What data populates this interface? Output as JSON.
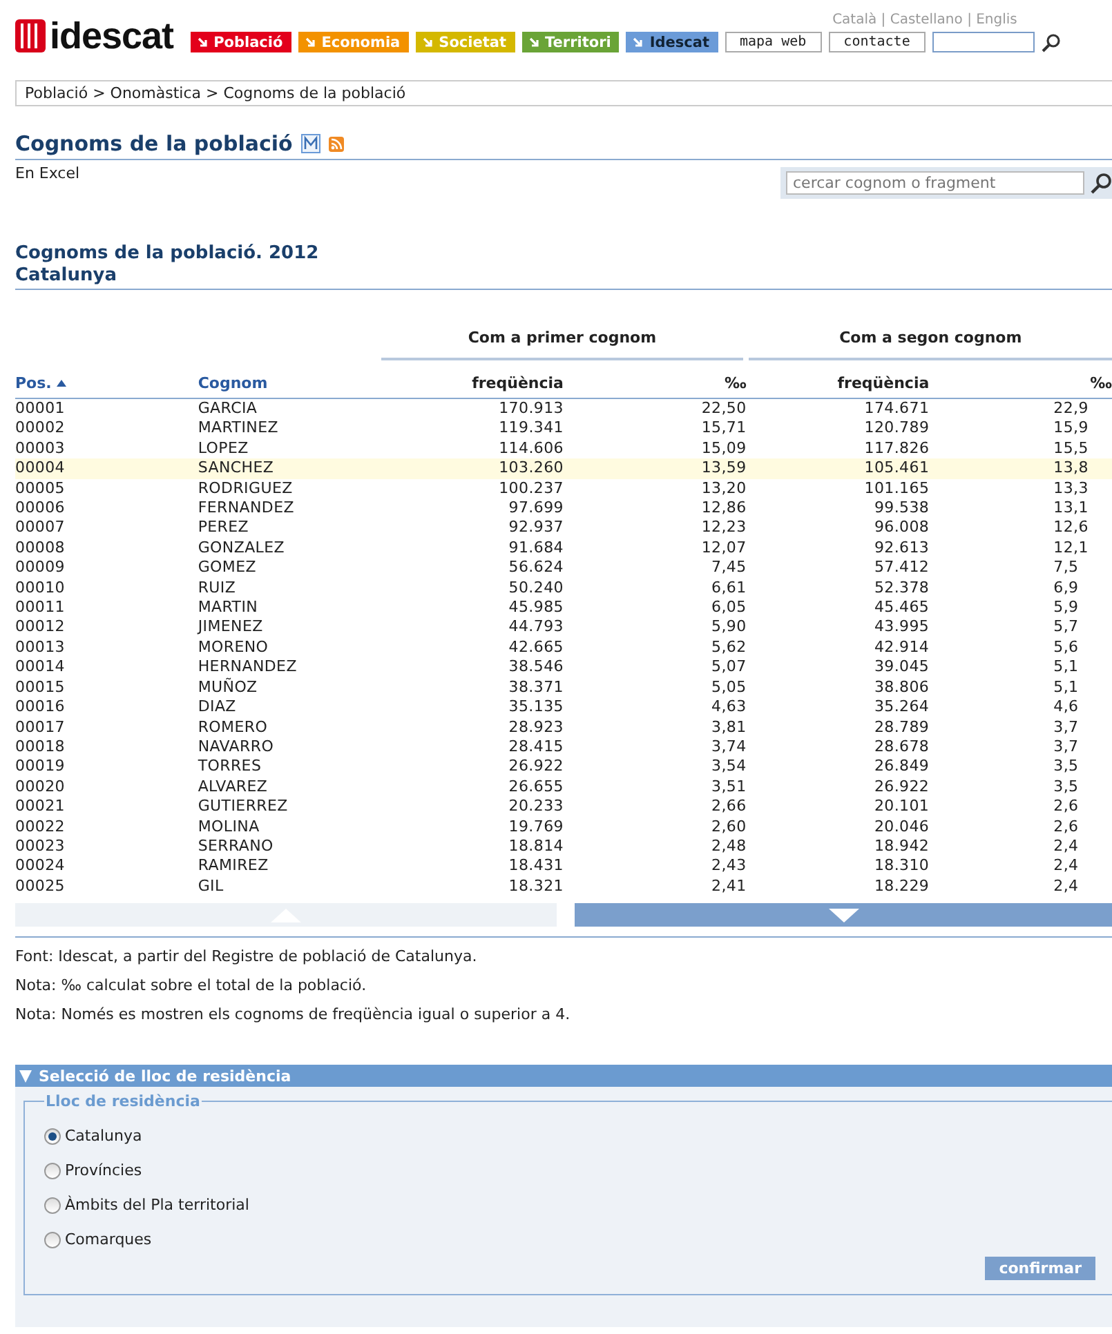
{
  "header": {
    "logo": "idescat",
    "languages": "Català | Castellano | Englis",
    "nav": [
      {
        "label": "Població",
        "color": "#e3001b"
      },
      {
        "label": "Economia",
        "color": "#f39200"
      },
      {
        "label": "Societat",
        "color": "#d4b800"
      },
      {
        "label": "Territori",
        "color": "#6aa437"
      },
      {
        "label": "Idescat",
        "color": "#6b9bd8"
      }
    ],
    "links": [
      "mapa web",
      "contacte"
    ]
  },
  "breadcrumb": "Població > Onomàstica > Cognoms de la població",
  "page_title": "Cognoms de la població",
  "excel_link": "En Excel",
  "search": {
    "placeholder": "cercar cognom o fragment"
  },
  "table": {
    "title": "Cognoms de la població. 2012",
    "subtitle": "Catalunya",
    "groups": [
      "Com a primer cognom",
      "Com a segon cognom"
    ],
    "columns": [
      "Pos.",
      "Cognom",
      "freqüència",
      "‰",
      "freqüència",
      "‰"
    ],
    "rows": [
      {
        "cells": [
          "00001",
          "GARCIA",
          "170.913",
          "22,50",
          "174.671",
          "22,9"
        ],
        "selected": false
      },
      {
        "cells": [
          "00002",
          "MARTINEZ",
          "119.341",
          "15,71",
          "120.789",
          "15,9"
        ],
        "selected": false
      },
      {
        "cells": [
          "00003",
          "LOPEZ",
          "114.606",
          "15,09",
          "117.826",
          "15,5"
        ],
        "selected": false
      },
      {
        "cells": [
          "00004",
          "SANCHEZ",
          "103.260",
          "13,59",
          "105.461",
          "13,8"
        ],
        "selected": true
      },
      {
        "cells": [
          "00005",
          "RODRIGUEZ",
          "100.237",
          "13,20",
          "101.165",
          "13,3"
        ],
        "selected": false
      },
      {
        "cells": [
          "00006",
          "FERNANDEZ",
          "97.699",
          "12,86",
          "99.538",
          "13,1"
        ],
        "selected": false
      },
      {
        "cells": [
          "00007",
          "PEREZ",
          "92.937",
          "12,23",
          "96.008",
          "12,6"
        ],
        "selected": false
      },
      {
        "cells": [
          "00008",
          "GONZALEZ",
          "91.684",
          "12,07",
          "92.613",
          "12,1"
        ],
        "selected": false
      },
      {
        "cells": [
          "00009",
          "GOMEZ",
          "56.624",
          "7,45",
          "57.412",
          "7,5"
        ],
        "selected": false
      },
      {
        "cells": [
          "00010",
          "RUIZ",
          "50.240",
          "6,61",
          "52.378",
          "6,9"
        ],
        "selected": false
      },
      {
        "cells": [
          "00011",
          "MARTIN",
          "45.985",
          "6,05",
          "45.465",
          "5,9"
        ],
        "selected": false
      },
      {
        "cells": [
          "00012",
          "JIMENEZ",
          "44.793",
          "5,90",
          "43.995",
          "5,7"
        ],
        "selected": false
      },
      {
        "cells": [
          "00013",
          "MORENO",
          "42.665",
          "5,62",
          "42.914",
          "5,6"
        ],
        "selected": false
      },
      {
        "cells": [
          "00014",
          "HERNANDEZ",
          "38.546",
          "5,07",
          "39.045",
          "5,1"
        ],
        "selected": false
      },
      {
        "cells": [
          "00015",
          "MUÑOZ",
          "38.371",
          "5,05",
          "38.806",
          "5,1"
        ],
        "selected": false
      },
      {
        "cells": [
          "00016",
          "DIAZ",
          "35.135",
          "4,63",
          "35.264",
          "4,6"
        ],
        "selected": false
      },
      {
        "cells": [
          "00017",
          "ROMERO",
          "28.923",
          "3,81",
          "28.789",
          "3,7"
        ],
        "selected": false
      },
      {
        "cells": [
          "00018",
          "NAVARRO",
          "28.415",
          "3,74",
          "28.678",
          "3,7"
        ],
        "selected": false
      },
      {
        "cells": [
          "00019",
          "TORRES",
          "26.922",
          "3,54",
          "26.849",
          "3,5"
        ],
        "selected": false
      },
      {
        "cells": [
          "00020",
          "ALVAREZ",
          "26.655",
          "3,51",
          "26.922",
          "3,5"
        ],
        "selected": false
      },
      {
        "cells": [
          "00021",
          "GUTIERREZ",
          "20.233",
          "2,66",
          "20.101",
          "2,6"
        ],
        "selected": false
      },
      {
        "cells": [
          "00022",
          "MOLINA",
          "19.769",
          "2,60",
          "20.046",
          "2,6"
        ],
        "selected": false
      },
      {
        "cells": [
          "00023",
          "SERRANO",
          "18.814",
          "2,48",
          "18.942",
          "2,4"
        ],
        "selected": false
      },
      {
        "cells": [
          "00024",
          "RAMIREZ",
          "18.431",
          "2,43",
          "18.310",
          "2,4"
        ],
        "selected": false
      },
      {
        "cells": [
          "00025",
          "GIL",
          "18.321",
          "2,41",
          "18.229",
          "2,4"
        ],
        "selected": false
      }
    ],
    "pager": [
      {
        "kind": "up",
        "disabled": true
      },
      {
        "kind": "down",
        "disabled": false
      }
    ]
  },
  "notes": [
    "Font: Idescat, a partir del Registre de població de Catalunya.",
    "Nota: ‰ calculat sobre el total de la població.",
    "Nota: Només es mostren els cognoms de freqüència igual o superior a 4."
  ],
  "residence": {
    "title": "Selecció de lloc de residència",
    "legend": "Lloc de residència",
    "options": [
      {
        "label": "Catalunya",
        "selected": true
      },
      {
        "label": "Províncies",
        "selected": false
      },
      {
        "label": "Àmbits del Pla territorial",
        "selected": false
      },
      {
        "label": "Comarques",
        "selected": false
      }
    ],
    "button": "confirmar"
  }
}
